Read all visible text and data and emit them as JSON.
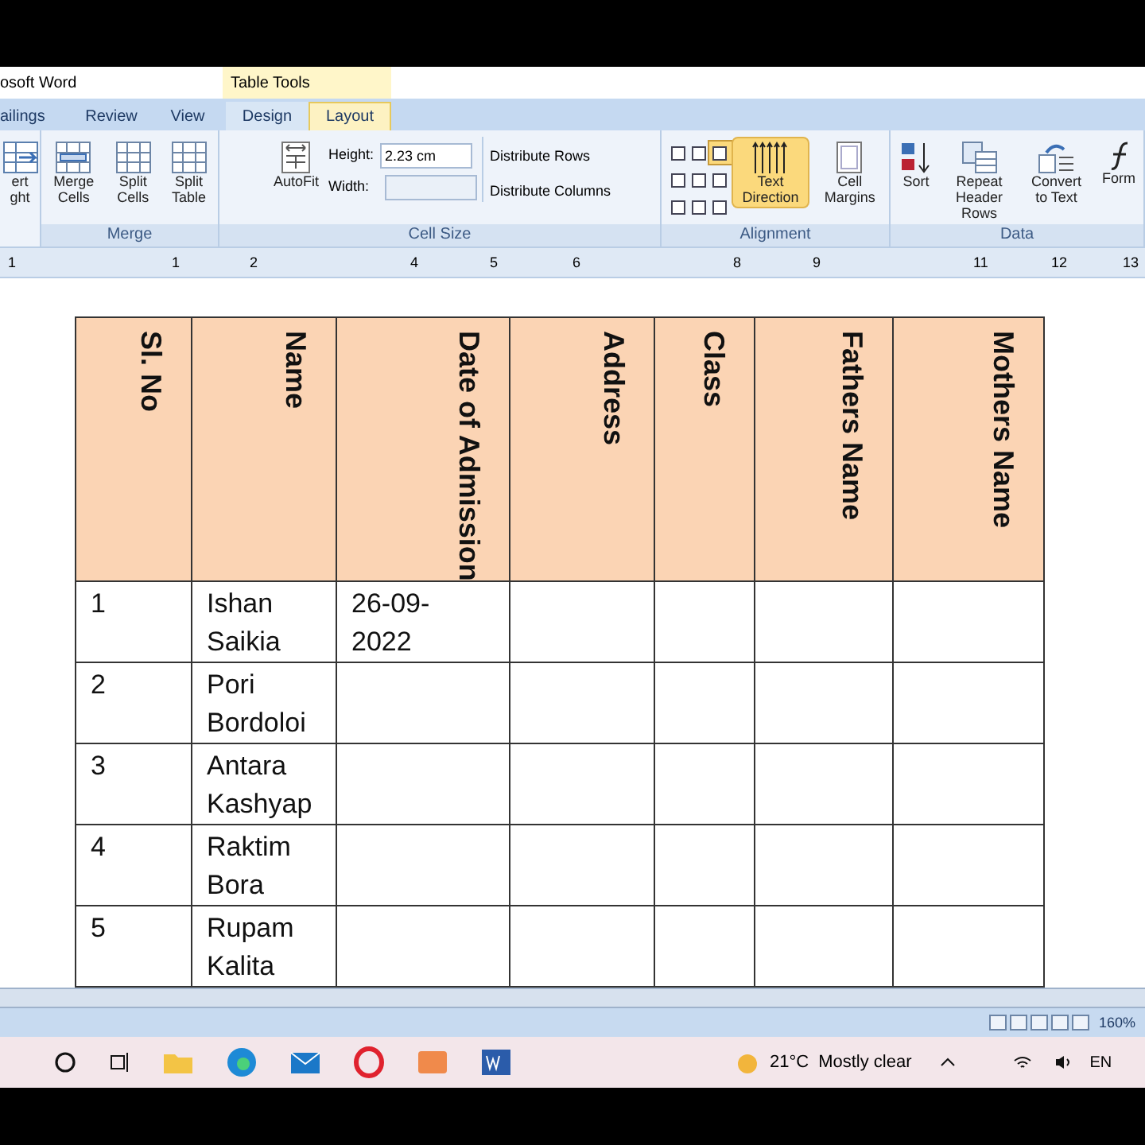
{
  "window": {
    "title": "osoft Word",
    "context_tab_group": "Table Tools"
  },
  "tabs": [
    {
      "label": "ailings",
      "selected": false,
      "context": false
    },
    {
      "label": "Review",
      "selected": false,
      "context": false
    },
    {
      "label": "View",
      "selected": false,
      "context": false
    },
    {
      "label": "Design",
      "selected": false,
      "context": true
    },
    {
      "label": "Layout",
      "selected": true,
      "context": true
    }
  ],
  "ribbon": {
    "groups": [
      {
        "buttons": [
          {
            "label": "ert ght"
          }
        ]
      },
      {
        "label": "Merge",
        "buttons": [
          {
            "label": "Merge Cells"
          },
          {
            "label": "Split Cells"
          },
          {
            "label": "Split Table"
          }
        ]
      },
      {
        "label": "Cell Size",
        "autofit": "AutoFit",
        "height_label": "Height:",
        "height_value": "2.23 cm",
        "width_label": "Width:",
        "distribute": [
          "Distribute Rows",
          "Distribute Columns"
        ]
      },
      {
        "label": "Alignment",
        "align_selected": [
          false,
          false,
          true,
          false,
          false,
          false,
          false,
          false,
          false
        ],
        "buttons": [
          {
            "label": "Text Direction",
            "hovered": true
          },
          {
            "label": "Cell Margins",
            "hovered": false
          }
        ]
      },
      {
        "label": "Data",
        "buttons": [
          {
            "label": "Sort"
          },
          {
            "label": "Repeat Header Rows"
          },
          {
            "label": "Convert to Text"
          },
          {
            "label": "Form"
          }
        ]
      }
    ]
  },
  "ruler": [
    "1",
    "1",
    "2",
    "4",
    "5",
    "6",
    "8",
    "9",
    "11",
    "12",
    "13"
  ],
  "table": {
    "columns": [
      "Sl. No",
      "Name",
      "Date of Admission",
      "Address",
      "Class",
      "Fathers Name",
      "Mothers Name"
    ],
    "rows": [
      [
        "1",
        "Ishan Saikia",
        "26-09-2022",
        "",
        "",
        "",
        ""
      ],
      [
        "2",
        "Pori Bordoloi",
        "",
        "",
        "",
        "",
        ""
      ],
      [
        "3",
        "Antara Kashyap",
        "",
        "",
        "",
        "",
        ""
      ],
      [
        "4",
        "Raktim Bora",
        "",
        "",
        "",
        "",
        ""
      ],
      [
        "5",
        "Rupam Kalita",
        "",
        "",
        "",
        "",
        ""
      ]
    ]
  },
  "status_bar": {
    "zoom": "160%"
  },
  "taskbar": {
    "weather_temp": "21°C",
    "weather_text": "Mostly clear",
    "language": "EN"
  }
}
